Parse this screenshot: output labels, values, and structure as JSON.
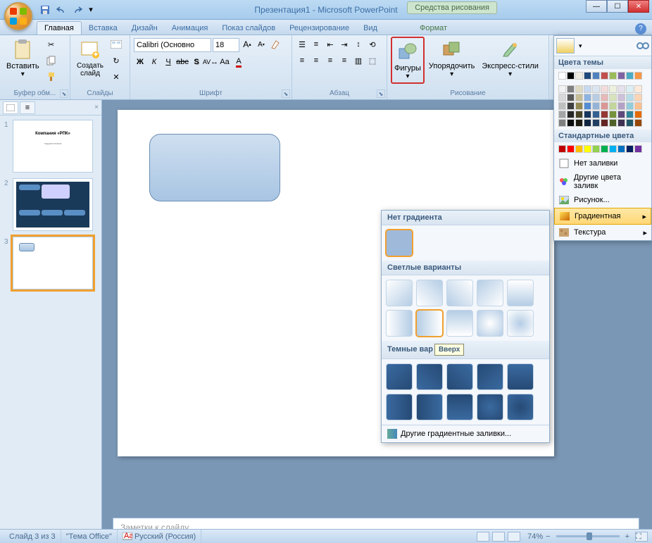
{
  "title": "Презентация1 - Microsoft PowerPoint",
  "tool_context": "Средства рисования",
  "tabs": {
    "home": "Главная",
    "insert": "Вставка",
    "design": "Дизайн",
    "anim": "Анимация",
    "show": "Показ слайдов",
    "review": "Рецензирование",
    "view": "Вид",
    "format": "Формат"
  },
  "groups": {
    "clipboard": "Буфер обм...",
    "slides": "Слайды",
    "font": "Шрифт",
    "paragraph": "Абзац",
    "drawing": "Рисование"
  },
  "buttons": {
    "paste": "Вставить",
    "new_slide": "Создать\nслайд",
    "shapes": "Фигуры",
    "arrange": "Упорядочить",
    "quick_styles": "Экспресс-стили"
  },
  "font": {
    "name": "Calibri (Основно",
    "size": "18"
  },
  "gradient_popup": {
    "no_gradient": "Нет градиента",
    "light": "Светлые варианты",
    "dark": "Темные варианты",
    "more": "Другие градиентные заливки...",
    "tooltip": "Вверх",
    "dark_header_visible": "Темные вар"
  },
  "color_dropdown": {
    "theme": "Цвета темы",
    "standard": "Стандартные цвета",
    "no_fill": "Нет заливки",
    "more_colors": "Другие цвета заливк",
    "picture": "Рисунок...",
    "gradient": "Градиентная",
    "texture": "Текстура"
  },
  "notes_placeholder": "Заметки к слайду",
  "status": {
    "slide": "Слайд 3 из 3",
    "theme": "\"Тема Office\"",
    "lang": "Русский (Россия)",
    "zoom": "74%"
  },
  "thumb1_text": "Компания «РПК»",
  "theme_colors": [
    "#ffffff",
    "#000000",
    "#eeece1",
    "#1f497d",
    "#4f81bd",
    "#c0504d",
    "#9bbb59",
    "#8064a2",
    "#4bacc6",
    "#f79646"
  ],
  "theme_tints": [
    [
      "#f2f2f2",
      "#7f7f7f",
      "#ddd9c3",
      "#c6d9f0",
      "#dbe5f1",
      "#f2dcdb",
      "#ebf1dd",
      "#e5e0ec",
      "#dbeef3",
      "#fdeada"
    ],
    [
      "#d8d8d8",
      "#595959",
      "#c4bd97",
      "#8db3e2",
      "#b8cce4",
      "#e5b9b7",
      "#d7e3bc",
      "#ccc1d9",
      "#b7dde8",
      "#fbd5b5"
    ],
    [
      "#bfbfbf",
      "#3f3f3f",
      "#938953",
      "#548dd4",
      "#95b3d7",
      "#d99694",
      "#c3d69b",
      "#b2a2c7",
      "#92cddc",
      "#fac08f"
    ],
    [
      "#a5a5a5",
      "#262626",
      "#494429",
      "#17365d",
      "#366092",
      "#953734",
      "#76923c",
      "#5f497a",
      "#31859b",
      "#e36c09"
    ],
    [
      "#7f7f7f",
      "#0c0c0c",
      "#1d1b10",
      "#0f243e",
      "#244061",
      "#632423",
      "#4f6128",
      "#3f3151",
      "#205867",
      "#974806"
    ]
  ],
  "standard_colors": [
    "#c00000",
    "#ff0000",
    "#ffc000",
    "#ffff00",
    "#92d050",
    "#00b050",
    "#00b0f0",
    "#0070c0",
    "#002060",
    "#7030a0"
  ]
}
